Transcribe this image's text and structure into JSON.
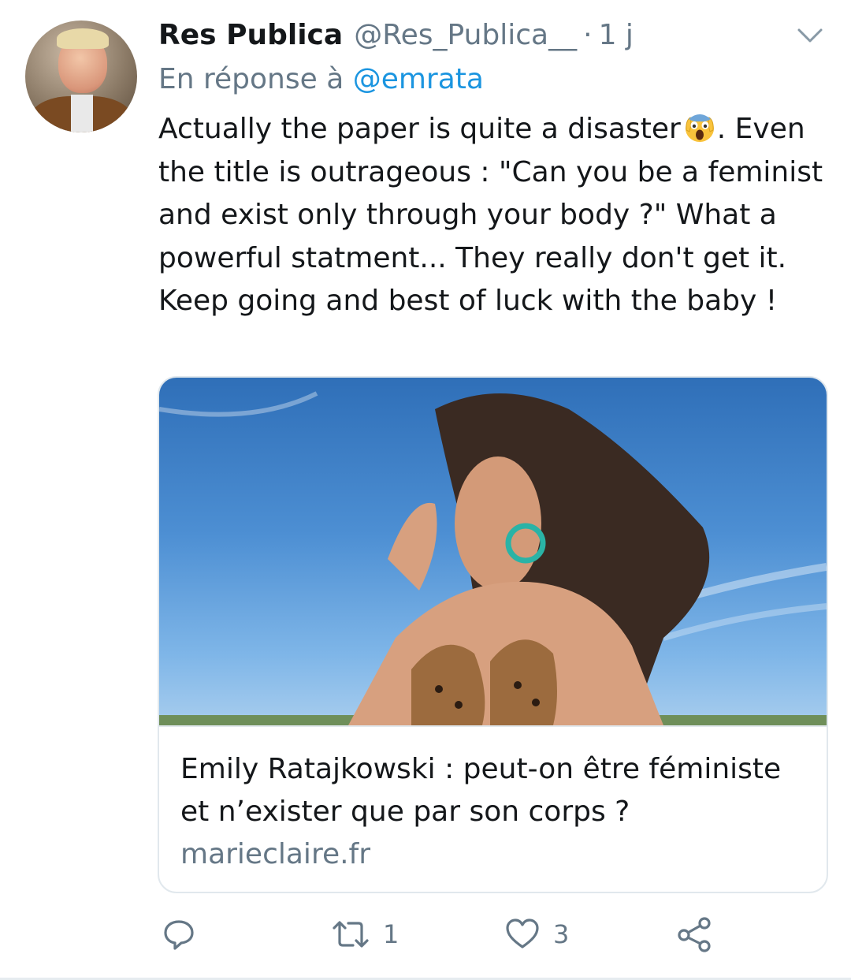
{
  "tweet": {
    "display_name": "Res Publica",
    "handle": "@Res_Publica__",
    "separator": "·",
    "time_ago": "1 j",
    "reply_prefix": "En réponse à",
    "reply_to": "@emrata",
    "text_before_emoji": "Actually the paper is quite a disaster",
    "emoji": "face-screaming-in-fear",
    "text_after_emoji": ". Even the title is outrageous : \"Can you be a feminist and exist only through your body ?\" What a powerful statment... They really don't get it. Keep going and best of luck with the baby !"
  },
  "card": {
    "title": "Emily Ratajkowski : peut-on être féministe et n’exister que par son corps ?",
    "domain": "marieclaire.fr"
  },
  "actions": {
    "reply_icon": "reply-icon",
    "retweet_icon": "retweet-icon",
    "retweet_count": "1",
    "like_icon": "heart-icon",
    "like_count": "3",
    "share_icon": "share-icon"
  },
  "colors": {
    "text": "#14171a",
    "secondary": "#657786",
    "link": "#1b95e0",
    "border": "#e1e8ed"
  }
}
